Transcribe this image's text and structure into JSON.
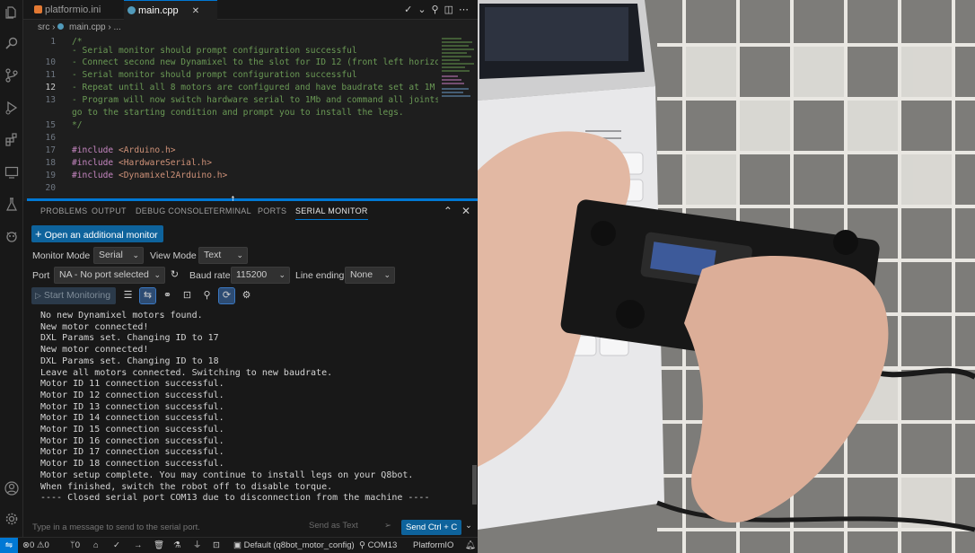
{
  "tabs": [
    {
      "label": "platformio.ini",
      "active": false
    },
    {
      "label": "main.cpp",
      "active": true
    }
  ],
  "breadcrumb": {
    "folder": "src",
    "file": "main.cpp",
    "more": "..."
  },
  "editor": {
    "lines": [
      {
        "num": "1",
        "text": "/*"
      },
      {
        "num": "",
        "text": "- Serial monitor should prompt configuration successful"
      },
      {
        "num": "10",
        "text": "- Connect second new Dynamixel to the slot for ID 12 (front left horizon"
      },
      {
        "num": "11",
        "text": "- Serial monitor should prompt configuration successful"
      },
      {
        "num": "12",
        "text": "- Repeat until all 8 motors are configured and have baudrate set at 1M"
      },
      {
        "num": "13",
        "text": "- Program will now switch hardware serial to 1Mb and command all joints"
      },
      {
        "num": "",
        "text": "go to the starting condition and prompt you to install the legs."
      },
      {
        "num": "15",
        "text": "*/"
      },
      {
        "num": "16",
        "text": ""
      },
      {
        "num": "17",
        "directive": "#include",
        "header": "<Arduino.h>"
      },
      {
        "num": "18",
        "directive": "#include",
        "header": "<HardwareSerial.h>"
      },
      {
        "num": "19",
        "directive": "#include",
        "header": "<Dynamixel2Arduino.h>"
      },
      {
        "num": "20",
        "text": ""
      }
    ]
  },
  "panel": {
    "tabs": [
      "PROBLEMS",
      "OUTPUT",
      "DEBUG CONSOLE",
      "TERMINAL",
      "PORTS",
      "SERIAL MONITOR"
    ],
    "active_tab": "SERIAL MONITOR",
    "open_monitor_label": "Open an additional monitor",
    "monitor_mode_label": "Monitor Mode",
    "monitor_mode_value": "Serial",
    "view_mode_label": "View Mode",
    "view_mode_value": "Text",
    "port_label": "Port",
    "port_value": "NA - No port selected",
    "baud_label": "Baud rate",
    "baud_value": "115200",
    "line_ending_label": "Line ending",
    "line_ending_value": "None",
    "start_label": "Start Monitoring",
    "output_lines": [
      "No new Dynamixel motors found.",
      "New motor connected!",
      "DXL Params set. Changing ID to 17",
      "New motor connected!",
      "DXL Params set. Changing ID to 18",
      "Leave all motors connected. Switching to new baudrate.",
      "Motor ID 11 connection successful.",
      "Motor ID 12 connection successful.",
      "Motor ID 13 connection successful.",
      "Motor ID 14 connection successful.",
      "Motor ID 15 connection successful.",
      "Motor ID 16 connection successful.",
      "Motor ID 17 connection successful.",
      "Motor ID 18 connection successful.",
      "Motor setup complete. You may continue to install legs on your Q8bot.",
      "When finished, switch the robot off to disable torque.",
      "---- Closed serial port COM13 due to disconnection from the machine ----"
    ],
    "input_placeholder": "Type in a message to send to the serial port.",
    "send_text_label": "Send as Text",
    "send_button_label": "Send Ctrl + C"
  },
  "statusbar": {
    "errors": "0",
    "warnings": "0",
    "ports": "0",
    "env": "Default (q8bot_motor_config)",
    "port": "COM13",
    "platformio": "PlatformIO"
  },
  "colors": {
    "accent": "#0078d4",
    "button": "#0e639c",
    "comment": "#6a9955",
    "keyword": "#c586c0",
    "string": "#ce9178"
  }
}
